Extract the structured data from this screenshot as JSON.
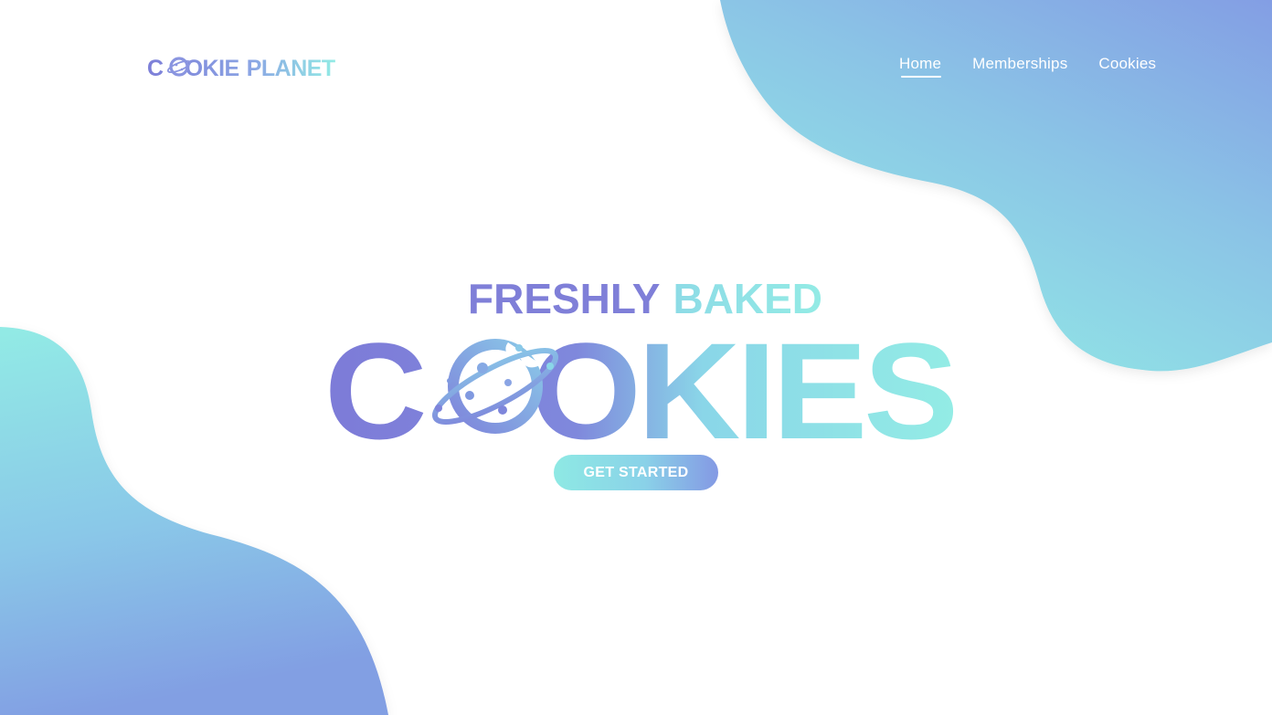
{
  "brand": {
    "name_part1": "COOKIE",
    "name_part2": "PLANET",
    "logo_icon": "cookie-planet-icon"
  },
  "nav": {
    "items": [
      {
        "label": "Home",
        "active": true
      },
      {
        "label": "Memberships",
        "active": false
      },
      {
        "label": "Cookies",
        "active": false
      }
    ]
  },
  "hero": {
    "line1_part1": "FRESHLY",
    "line1_part2": "BAKED",
    "line2": "COOKIES",
    "cta_label": "GET STARTED"
  },
  "colors": {
    "purple": "#7f7fd9",
    "violet": "#8a86e0",
    "aqua": "#93ece6",
    "sky": "#8ac9e8",
    "white": "#ffffff"
  }
}
